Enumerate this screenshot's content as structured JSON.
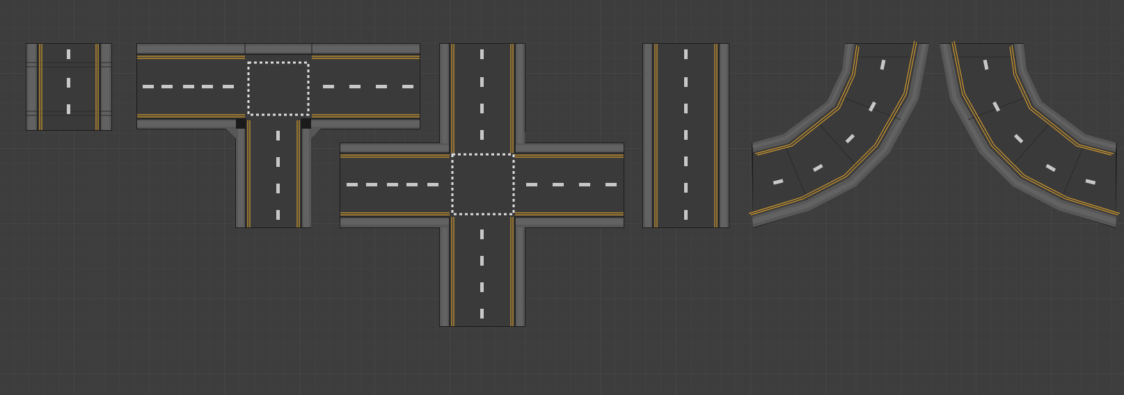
{
  "viewport": {
    "background_color": "#3d3d3d",
    "grid_minor_color": "#454545",
    "grid_major_color": "#4a4a4a",
    "road_asphalt_color": "#3a3a3a",
    "road_edge_color": "#1b1b1b",
    "sidewalk_color": "#575757",
    "sidewalk_top_color": "#626262",
    "centerline_color": "#c8c8c8",
    "yellow_line_color": "#d29a2c",
    "crosswalk_color": "#dedede"
  },
  "tiles": [
    {
      "name": "road-tile-short-straight",
      "kind": "straight-short"
    },
    {
      "name": "road-tile-t-intersection",
      "kind": "t-junction"
    },
    {
      "name": "road-tile-four-way-intersection",
      "kind": "cross"
    },
    {
      "name": "road-tile-long-straight",
      "kind": "straight-long"
    },
    {
      "name": "road-tile-curve-left",
      "kind": "curve"
    },
    {
      "name": "road-tile-curve-right",
      "kind": "curve"
    }
  ]
}
